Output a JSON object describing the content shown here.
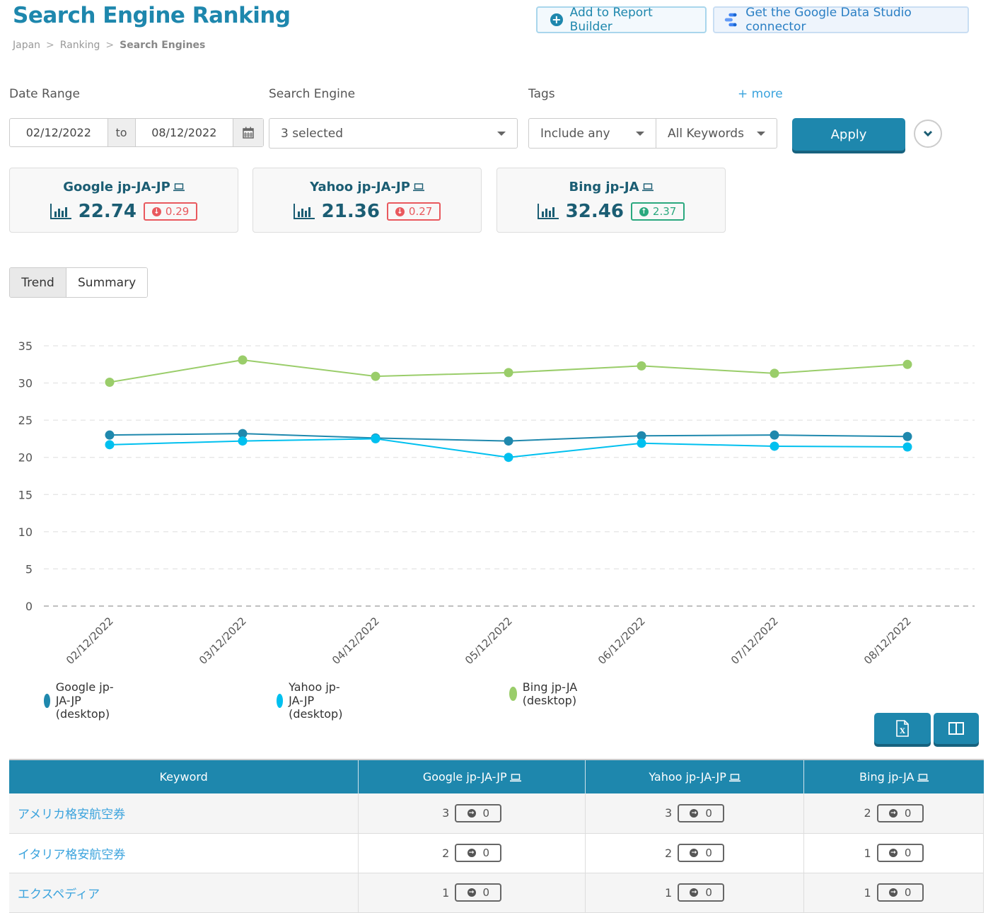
{
  "header": {
    "title": "Search Engine Ranking",
    "breadcrumb": [
      "Japan",
      "Ranking",
      "Search Engines"
    ],
    "breadcrumb_separator": ">",
    "add_report_label": "Add to Report Builder",
    "gds_label": "Get the Google Data Studio connector"
  },
  "filters": {
    "date_range_label": "Date Range",
    "date_from": "02/12/2022",
    "date_to_label": "to",
    "date_to": "08/12/2022",
    "search_engine_label": "Search Engine",
    "search_engine_value": "3 selected",
    "tags_label": "Tags",
    "more_label": "+ more",
    "tags_mode": "Include any",
    "tags_value": "All Keywords",
    "apply_label": "Apply"
  },
  "cards": [
    {
      "name": "Google jp-JA-JP",
      "value": "22.74",
      "change": "0.29",
      "direction": "down"
    },
    {
      "name": "Yahoo jp-JA-JP",
      "value": "21.36",
      "change": "0.27",
      "direction": "down"
    },
    {
      "name": "Bing jp-JA",
      "value": "32.46",
      "change": "2.37",
      "direction": "up"
    }
  ],
  "views": {
    "trend": "Trend",
    "summary": "Summary",
    "active": "Trend"
  },
  "colors": {
    "primary": "#1e87ad",
    "google": "#1f88ad",
    "yahoo": "#00c0ef",
    "bing": "#9acd6a",
    "down": "#e9595e",
    "up": "#2aa87e"
  },
  "chart_data": {
    "type": "line",
    "title": "",
    "xlabel": "",
    "ylabel": "",
    "x": [
      "02/12/2022",
      "03/12/2022",
      "04/12/2022",
      "05/12/2022",
      "06/12/2022",
      "07/12/2022",
      "08/12/2022"
    ],
    "ylim": [
      0,
      35
    ],
    "yticks": [
      0,
      5,
      10,
      15,
      20,
      25,
      30,
      35
    ],
    "grid": true,
    "legend_position": "bottom-left",
    "series": [
      {
        "name": "Google jp-JA-JP (desktop)",
        "color": "#1f88ad",
        "values": [
          23.0,
          23.2,
          22.6,
          22.2,
          22.9,
          23.0,
          22.8
        ]
      },
      {
        "name": "Yahoo jp-JA-JP (desktop)",
        "color": "#00c0ef",
        "values": [
          21.7,
          22.2,
          22.5,
          20.0,
          21.9,
          21.5,
          21.4
        ]
      },
      {
        "name": "Bing jp-JA (desktop)",
        "color": "#9acd6a",
        "values": [
          30.1,
          33.1,
          30.9,
          31.4,
          32.3,
          31.3,
          32.5
        ]
      }
    ]
  },
  "table": {
    "headers": [
      "Keyword",
      "Google jp-JA-JP",
      "Yahoo jp-JA-JP",
      "Bing jp-JA"
    ],
    "rows": [
      {
        "keyword": "アメリカ格安航空券",
        "cells": [
          {
            "rank": "3",
            "change": "0"
          },
          {
            "rank": "3",
            "change": "0"
          },
          {
            "rank": "2",
            "change": "0"
          }
        ]
      },
      {
        "keyword": "イタリア格安航空券",
        "cells": [
          {
            "rank": "2",
            "change": "0"
          },
          {
            "rank": "2",
            "change": "0"
          },
          {
            "rank": "1",
            "change": "0"
          }
        ]
      },
      {
        "keyword": "エクスペディア",
        "cells": [
          {
            "rank": "1",
            "change": "0"
          },
          {
            "rank": "1",
            "change": "0"
          },
          {
            "rank": "1",
            "change": "0"
          }
        ]
      }
    ]
  }
}
